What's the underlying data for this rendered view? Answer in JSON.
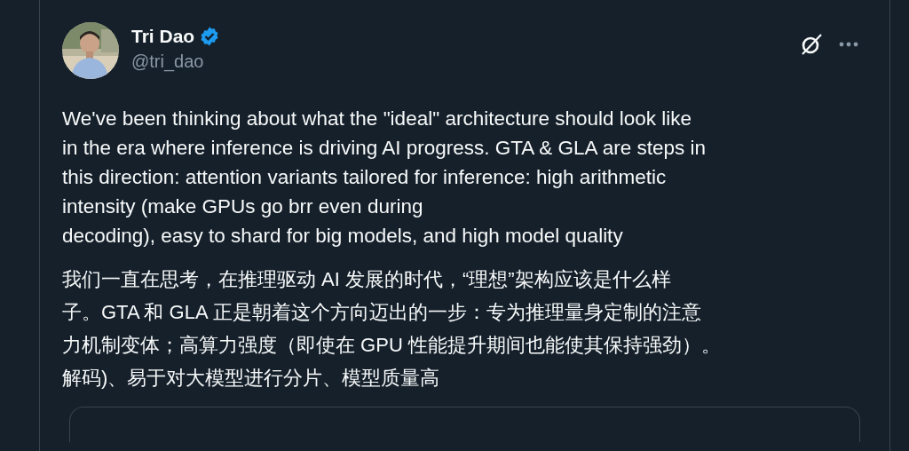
{
  "author": {
    "name": "Tri Dao",
    "verified": true,
    "handle": "@tri_dao"
  },
  "body_lines": [
    "We've been thinking about what the \"ideal\" architecture should look like",
    "in the era where inference is driving AI progress. GTA & GLA are steps in",
    "this direction: attention variants tailored for inference: high arithmetic",
    "intensity (make GPUs go brr even during",
    "decoding), easy to shard for big models, and high model quality"
  ],
  "translation_lines": [
    "我们一直在思考，在推理驱动 AI 发展的时代，“理想”架构应该是什么样",
    "子。GTA 和 GLA 正是朝着这个方向迈出的一步：专为推理量身定制的注意",
    "力机制变体；高算力强度（即使在 GPU 性能提升期间也能使其保持强劲）。",
    "解码)、易于对大模型进行分片、模型质量高"
  ],
  "actions": [
    {
      "kind": "grok"
    },
    {
      "kind": "more"
    }
  ]
}
